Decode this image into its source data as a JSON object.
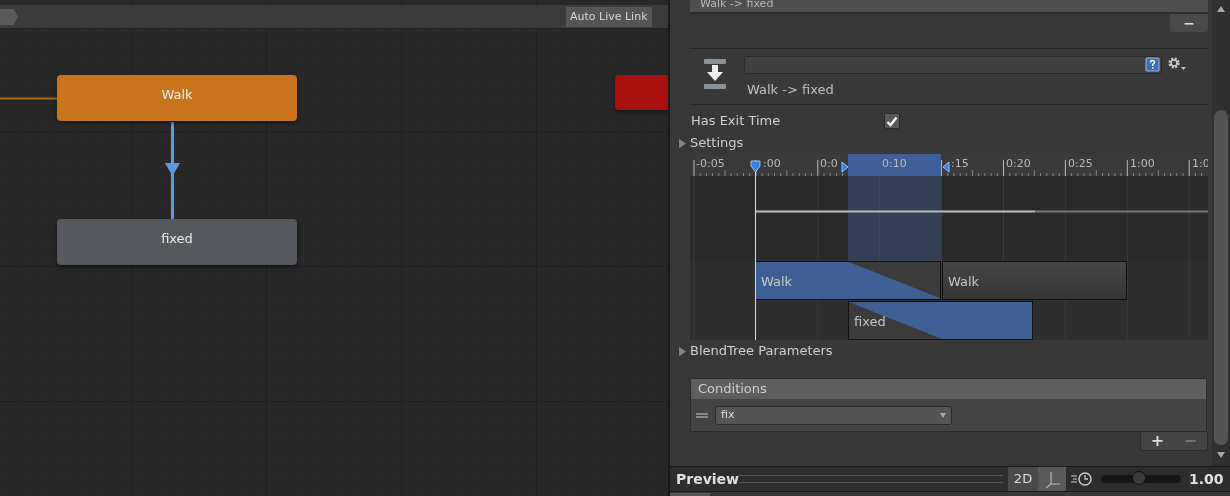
{
  "graph": {
    "toolbar": {
      "button": "Auto Live Link"
    },
    "states": [
      {
        "label": "Walk",
        "color": "#c8741c"
      },
      {
        "label": "fixed",
        "color": "#55585c"
      },
      {
        "color": "#a80f0f"
      }
    ]
  },
  "inspector": {
    "transitions": {
      "rows": [
        {
          "label": "Walk -> fixed"
        }
      ],
      "remove": "−"
    },
    "header": {
      "subtitle": "Walk -> fixed"
    },
    "has_exit_time": {
      "label": "Has Exit Time",
      "checked": true
    },
    "settings": {
      "label": "Settings",
      "expanded": false
    },
    "timeline": {
      "ticks": [
        "-0:05",
        ":00",
        "0:0",
        "0:10",
        ":15",
        "0:20",
        "0:25",
        "1:00",
        "1:0"
      ],
      "clips": [
        {
          "label": "Walk",
          "kind": "source"
        },
        {
          "label": "Walk",
          "kind": "plain"
        },
        {
          "label": "fixed",
          "kind": "target"
        }
      ]
    },
    "blendtree": {
      "label": "BlendTree Parameters",
      "expanded": false
    },
    "conditions": {
      "title": "Conditions",
      "items": [
        {
          "parameter": "fix"
        }
      ],
      "add": "+",
      "remove": "−"
    }
  },
  "preview": {
    "title": "Preview",
    "mode": "2D",
    "speed": {
      "level": 0.47,
      "reading": "1.00"
    }
  }
}
